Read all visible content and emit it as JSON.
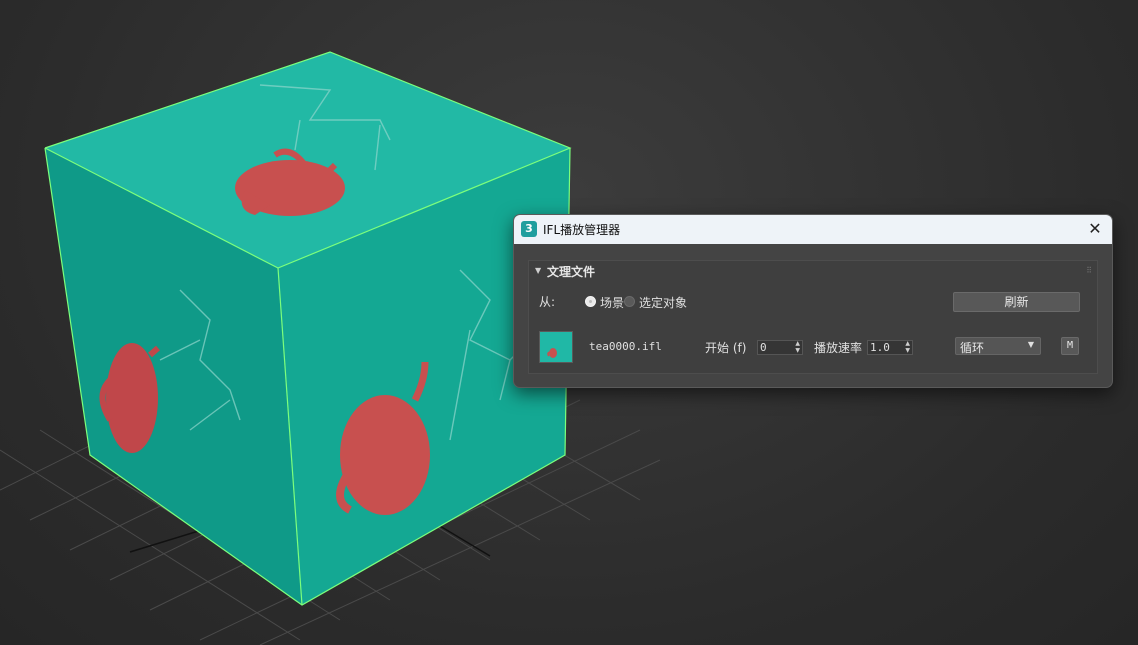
{
  "dialog": {
    "title": "IFL播放管理器",
    "app_icon": "3",
    "close_glyph": "✕"
  },
  "rollout": {
    "title": "文理文件",
    "arrow": "▼",
    "grip": "⠿"
  },
  "source": {
    "label": "从:",
    "options": [
      {
        "label": "场景",
        "checked": true
      },
      {
        "label": "选定对象",
        "checked": false
      }
    ],
    "refresh_label": "刷新"
  },
  "file": {
    "name": "tea0000.ifl",
    "start_label": "开始 (f)",
    "start_value": "0",
    "rate_label": "播放速率",
    "rate_value": "1.0",
    "mode_value": "循环",
    "m_button": "M"
  },
  "colors": {
    "cube_top": "#22b9a5",
    "cube_left": "#0f9a88",
    "cube_right": "#14a893",
    "teapot": "#c8504f",
    "edge": "#7cff7c"
  }
}
